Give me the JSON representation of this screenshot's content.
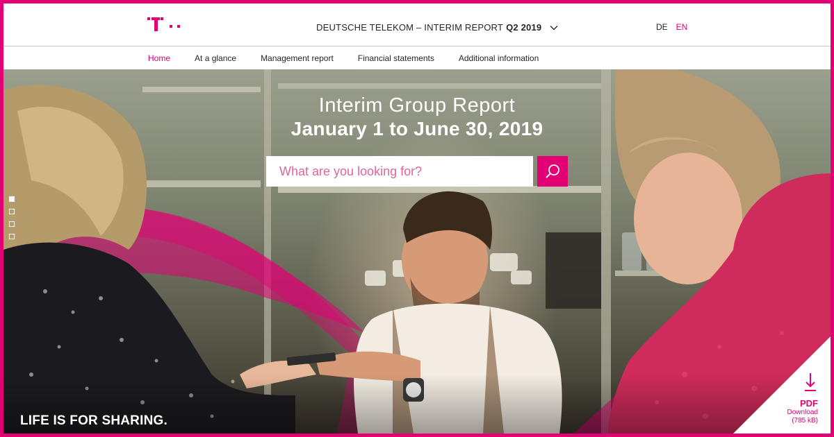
{
  "brand": {
    "name": "Telekom",
    "color": "#e20074"
  },
  "header": {
    "report_title_prefix": "DEUTSCHE TELEKOM – INTERIM REPORT",
    "report_title_period": "Q2 2019",
    "languages": [
      "DE",
      "EN"
    ],
    "active_language": "EN"
  },
  "nav": {
    "items": [
      {
        "label": "Home",
        "active": true
      },
      {
        "label": "At a glance",
        "active": false
      },
      {
        "label": "Management report",
        "active": false
      },
      {
        "label": "Financial statements",
        "active": false
      },
      {
        "label": "Additional information",
        "active": false
      }
    ]
  },
  "hero": {
    "title": "Interim Group Report",
    "subtitle": "January 1 to June 30, 2019",
    "search_placeholder": "What are you looking for?",
    "slide_count": 4,
    "active_slide": 1,
    "slogan": "LIFE IS FOR SHARING."
  },
  "pdf": {
    "label": "PDF",
    "action": "Download",
    "size": "(785 kB)"
  },
  "icons": {
    "logo": "telekom-t-logo",
    "dropdown": "chevron-down-icon",
    "search": "search-icon",
    "download": "download-icon"
  }
}
